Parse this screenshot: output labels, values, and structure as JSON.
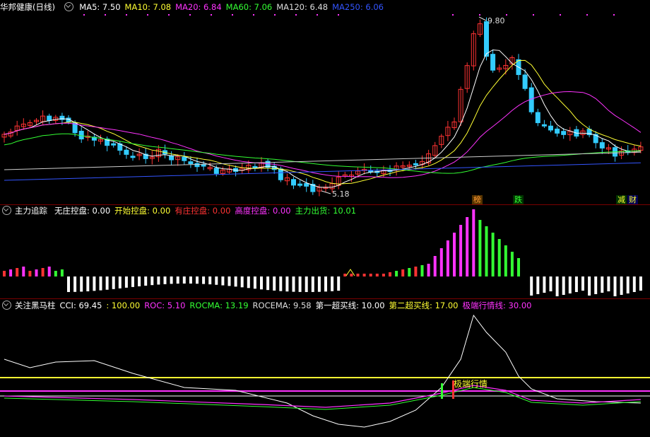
{
  "main": {
    "title": "华邦健康(日线)",
    "ma_labels": [
      {
        "text": "MA5: 7.50",
        "color": "#ffffff"
      },
      {
        "text": "MA10: 7.08",
        "color": "#ffff33"
      },
      {
        "text": "MA20: 6.84",
        "color": "#ff33ff"
      },
      {
        "text": "MA60: 7.06",
        "color": "#33ff33"
      },
      {
        "text": "MA120: 6.48",
        "color": "#dddddd"
      },
      {
        "text": "MA250: 6.06",
        "color": "#3355ff"
      }
    ],
    "high_label": "9.80",
    "low_label": "5.18",
    "flags": [
      {
        "text": "榜",
        "color": "#ff9933",
        "bg": "#553300"
      },
      {
        "text": "跌",
        "color": "#33ff33",
        "bg": "#003300"
      },
      {
        "text": "减",
        "color": "#ffff33",
        "bg": "#003300"
      },
      {
        "text": "财",
        "color": "#ffff33",
        "bg": "#000055"
      }
    ]
  },
  "zl": {
    "title": "主力追踪",
    "labels": [
      {
        "text": "无庄控盘: 0.00",
        "color": "#ffffff"
      },
      {
        "text": "开始控盘: 0.00",
        "color": "#ffff33"
      },
      {
        "text": "有庄控盘: 0.00",
        "color": "#ff3333"
      },
      {
        "text": "高度控盘: 0.00",
        "color": "#ff33ff"
      },
      {
        "text": "主力出货: 10.01",
        "color": "#33ff33"
      }
    ]
  },
  "hm": {
    "title": "关注黑马柱",
    "labels": [
      {
        "text": "CCI: 69.45",
        "color": "#ffffff"
      },
      {
        "text": ": 100.00",
        "color": "#ffff33"
      },
      {
        "text": "ROC: 5.10",
        "color": "#ff33ff"
      },
      {
        "text": "ROCMA: 13.19",
        "color": "#33ff33"
      },
      {
        "text": "ROCEMA: 9.58",
        "color": "#dddddd"
      },
      {
        "text": "第一超买线: 10.00",
        "color": "#ffffff"
      },
      {
        "text": "第二超买线: 17.00",
        "color": "#ffff33"
      },
      {
        "text": "极端行情线: 30.00",
        "color": "#ff33ff"
      }
    ],
    "annotation": "极端行情"
  },
  "colors": {
    "up": "#ff3333",
    "down": "#33ccff",
    "separator": "#7a0000"
  }
}
